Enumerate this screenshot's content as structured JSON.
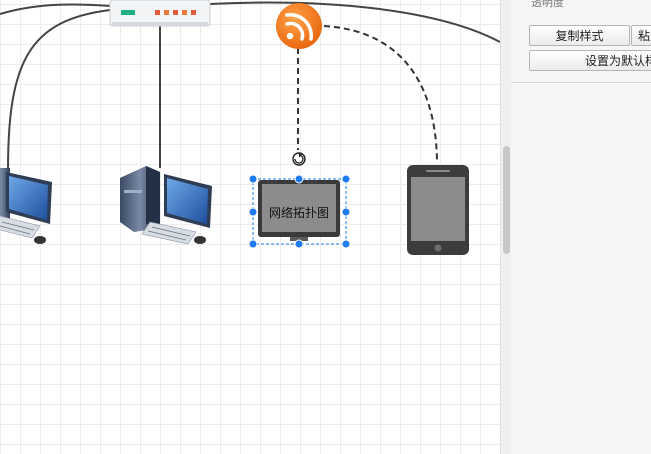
{
  "panel": {
    "cut_label": "透明度",
    "copy_style_button": "复制样式",
    "paste_style_button": "粘贴样式",
    "set_default_button": "设置为默认样式"
  },
  "canvas": {
    "selected_shape_label": "网络拓扑图"
  },
  "icons": {
    "rss": "rss-feed-icon",
    "switch": "network-switch-icon",
    "desktop": "desktop-computer-icon",
    "monitor": "monitor-icon",
    "tablet": "tablet-icon",
    "rotate": "rotate-handle-icon"
  },
  "colors": {
    "rss_orange": "#f07b1c",
    "handle_blue": "#1e7bf0",
    "connector": "#444444",
    "panel_bg": "#f6f6f6"
  }
}
